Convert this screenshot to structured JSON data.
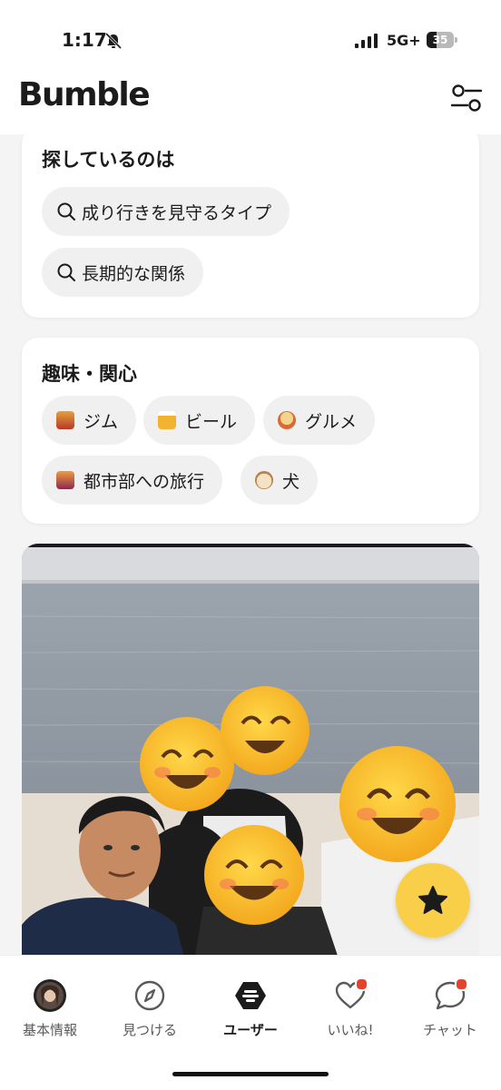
{
  "status_bar": {
    "time": "1:17",
    "network": "5G+",
    "battery": "35"
  },
  "header": {
    "app_name": "Bumble"
  },
  "looking_for": {
    "title": "探しているのは",
    "chips": [
      "成り行きを見守るタイプ",
      "長期的な関係"
    ]
  },
  "interests": {
    "title": "趣味・関心",
    "chips": [
      "ジム",
      "ビール",
      "グルメ",
      "都市部への旅行",
      "犬"
    ],
    "icons": [
      "weightlifter-emoji",
      "beer-emoji",
      "ramen-emoji",
      "city-sunset-emoji",
      "dog-emoji"
    ]
  },
  "tabs": [
    {
      "label": "基本情報",
      "icon": "avatar"
    },
    {
      "label": "見つける",
      "icon": "compass-icon"
    },
    {
      "label": "ユーザー",
      "icon": "bumble-hive-icon",
      "active": true
    },
    {
      "label": "いいね!",
      "icon": "heart-icon",
      "badge": true
    },
    {
      "label": "チャット",
      "icon": "chat-bubble-icon",
      "badge": true
    }
  ],
  "colors": {
    "accent": "#f9cf4a",
    "badge": "#e6412b",
    "chip_bg": "#f0f0f0"
  }
}
